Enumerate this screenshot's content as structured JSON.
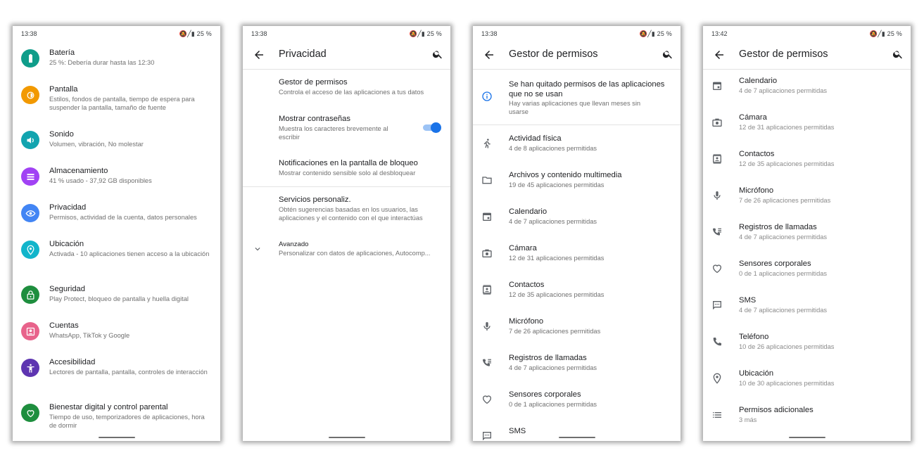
{
  "screen1": {
    "status": {
      "time": "13:38",
      "battery": "25 %"
    },
    "items": [
      {
        "title": "Batería",
        "subtitle": "25 %: Debería durar hasta las 12:30",
        "icon": "battery-icon",
        "color": "#0f9d8a"
      },
      {
        "title": "Pantalla",
        "subtitle": "Estilos, fondos de pantalla, tiempo de espera para suspender la pantalla, tamaño de fuente",
        "icon": "brightness-icon",
        "color": "#f29900"
      },
      {
        "title": "Sonido",
        "subtitle": "Volumen, vibración, No molestar",
        "icon": "volume-icon",
        "color": "#12a4af"
      },
      {
        "title": "Almacenamiento",
        "subtitle": "41 % usado - 37,92 GB disponibles",
        "icon": "storage-icon",
        "color": "#a142f4"
      },
      {
        "title": "Privacidad",
        "subtitle": "Permisos, actividad de la cuenta, datos personales",
        "icon": "privacy-eye-icon",
        "color": "#4285f4"
      },
      {
        "title": "Ubicación",
        "subtitle": "Activada - 10 aplicaciones tienen acceso a la ubicación",
        "icon": "location-icon",
        "color": "#12b5cb"
      },
      {
        "title": "Seguridad",
        "subtitle": "Play Protect, bloqueo de pantalla y huella digital",
        "icon": "lock-icon",
        "color": "#1e8e3e"
      },
      {
        "title": "Cuentas",
        "subtitle": "WhatsApp, TikTok y Google",
        "icon": "account-icon",
        "color": "#e8638b"
      },
      {
        "title": "Accesibilidad",
        "subtitle": "Lectores de pantalla, pantalla, controles de interacción",
        "icon": "accessibility-icon",
        "color": "#5e35b1"
      },
      {
        "title": "Bienestar digital y control parental",
        "subtitle": "Tiempo de uso, temporizadores de aplicaciones, hora de dormir",
        "icon": "wellbeing-icon",
        "color": "#1e8e3e"
      }
    ]
  },
  "screen2": {
    "status": {
      "time": "13:38",
      "battery": "25 %"
    },
    "title": "Privacidad",
    "items": [
      {
        "title": "Gestor de permisos",
        "subtitle": "Controla el acceso de las aplicaciones a tus datos"
      },
      {
        "title": "Mostrar contraseñas",
        "subtitle": "Muestra los caracteres brevemente al escribir"
      },
      {
        "title": "Notificaciones en la pantalla de bloqueo",
        "subtitle": "Mostrar contenido sensible solo al desbloquear"
      },
      {
        "title": "Servicios personaliz.",
        "subtitle": "Obtén sugerencias basadas en los usuarios, las aplicaciones y el contenido con el que interactúas"
      },
      {
        "title": "Avanzado",
        "subtitle": "Personalizar con datos de aplicaciones, Autocomp..."
      }
    ],
    "toggle_on": true,
    "accent": "#1a73e8"
  },
  "screen3": {
    "status": {
      "time": "13:38",
      "battery": "25 %"
    },
    "title": "Gestor de permisos",
    "notice": {
      "title": "Se han quitado permisos de las aplicaciones que no se usan",
      "subtitle": "Hay varias aplicaciones que llevan meses sin usarse",
      "icon": "info-icon"
    },
    "items": [
      {
        "title": "Actividad física",
        "subtitle": "4 de 8 aplicaciones permitidas",
        "icon": "running-icon"
      },
      {
        "title": "Archivos y contenido multimedia",
        "subtitle": "19 de 45 aplicaciones permitidas",
        "icon": "folder-icon"
      },
      {
        "title": "Calendario",
        "subtitle": "4 de 7 aplicaciones permitidas",
        "icon": "calendar-icon"
      },
      {
        "title": "Cámara",
        "subtitle": "12 de 31 aplicaciones permitidas",
        "icon": "camera-icon"
      },
      {
        "title": "Contactos",
        "subtitle": "12 de 35 aplicaciones permitidas",
        "icon": "contacts-icon"
      },
      {
        "title": "Micrófono",
        "subtitle": "7 de 26 aplicaciones permitidas",
        "icon": "microphone-icon"
      },
      {
        "title": "Registros de llamadas",
        "subtitle": "4 de 7 aplicaciones permitidas",
        "icon": "call-log-icon"
      },
      {
        "title": "Sensores corporales",
        "subtitle": "0 de 1 aplicaciones permitidas",
        "icon": "heart-icon"
      },
      {
        "title": "SMS",
        "subtitle": "",
        "icon": "sms-icon"
      }
    ]
  },
  "screen4": {
    "status": {
      "time": "13:42",
      "battery": "25 %"
    },
    "title": "Gestor de permisos",
    "items": [
      {
        "title": "Calendario",
        "subtitle": "4 de 7 aplicaciones permitidas",
        "icon": "calendar-icon"
      },
      {
        "title": "Cámara",
        "subtitle": "12 de 31 aplicaciones permitidas",
        "icon": "camera-icon"
      },
      {
        "title": "Contactos",
        "subtitle": "12 de 35 aplicaciones permitidas",
        "icon": "contacts-icon"
      },
      {
        "title": "Micrófono",
        "subtitle": "7 de 26 aplicaciones permitidas",
        "icon": "microphone-icon"
      },
      {
        "title": "Registros de llamadas",
        "subtitle": "4 de 7 aplicaciones permitidas",
        "icon": "call-log-icon"
      },
      {
        "title": "Sensores corporales",
        "subtitle": "0 de 1 aplicaciones permitidas",
        "icon": "heart-icon"
      },
      {
        "title": "SMS",
        "subtitle": "4 de 7 aplicaciones permitidas",
        "icon": "sms-icon"
      },
      {
        "title": "Teléfono",
        "subtitle": "10 de 26 aplicaciones permitidas",
        "icon": "phone-icon"
      },
      {
        "title": "Ubicación",
        "subtitle": "10 de 30 aplicaciones permitidas",
        "icon": "location-icon"
      },
      {
        "title": "Permisos adicionales",
        "subtitle": "3 más",
        "icon": "list-icon"
      }
    ]
  }
}
